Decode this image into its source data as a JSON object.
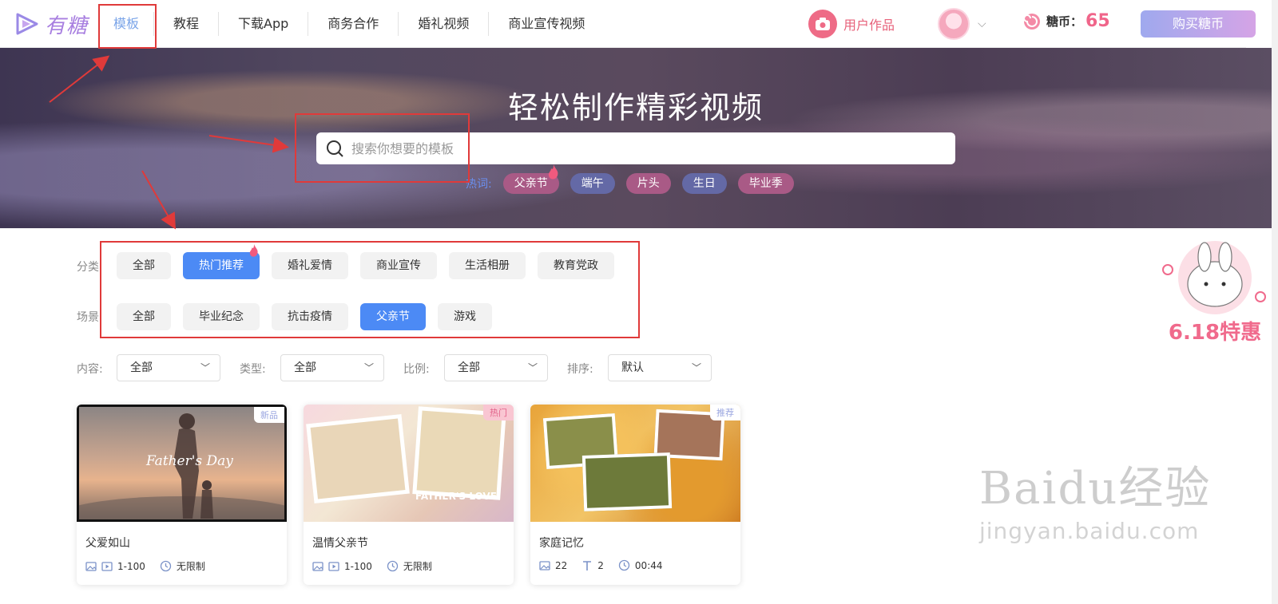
{
  "header": {
    "logo_text": "有糖",
    "nav": [
      "模板",
      "教程",
      "下载App",
      "商务合作",
      "婚礼视频",
      "商业宣传视频"
    ],
    "user_works": "用户作品",
    "candy_label": "糖币：",
    "candy_count": "65",
    "buy_button": "购买糖币"
  },
  "banner": {
    "title": "轻松制作精彩视频",
    "search_placeholder": "搜索你想要的模板",
    "hot_label": "热词:",
    "hot_tags": [
      "父亲节",
      "端午",
      "片头",
      "生日",
      "毕业季"
    ]
  },
  "filters": {
    "category_label": "分类",
    "categories": [
      "全部",
      "热门推荐",
      "婚礼爱情",
      "商业宣传",
      "生活相册",
      "教育党政"
    ],
    "active_category": "热门推荐",
    "scene_label": "场景",
    "scenes": [
      "全部",
      "毕业纪念",
      "抗击疫情",
      "父亲节",
      "游戏"
    ],
    "active_scene": "父亲节",
    "dropdowns": [
      {
        "label": "内容:",
        "value": "全部"
      },
      {
        "label": "类型:",
        "value": "全部"
      },
      {
        "label": "比例:",
        "value": "全部"
      },
      {
        "label": "排序:",
        "value": "默认"
      }
    ]
  },
  "cards": [
    {
      "badge": "新品",
      "badge_color": "#9aa6e0",
      "thumb_text": "Father's Day",
      "title": "父爱如山",
      "meta1": "1-100",
      "meta2": "无限制",
      "meta_type": "media"
    },
    {
      "badge": "热门",
      "badge_color": "#f08aa6",
      "thumb_text": "FATHER'S LOVE",
      "title": "温情父亲节",
      "meta1": "1-100",
      "meta2": "无限制",
      "meta_type": "media"
    },
    {
      "badge": "推荐",
      "badge_color": "#9aa6e0",
      "thumb_text": "",
      "title": "家庭记忆",
      "meta1": "22",
      "meta2": "2",
      "meta3": "00:44",
      "meta_type": "text"
    }
  ],
  "promo": {
    "text": "6.18特惠"
  },
  "watermark": {
    "brand": "Baidu经验",
    "url": "jingyan.baidu.com"
  },
  "colors": {
    "accent": "#4c8af5",
    "candy": "#f0658a",
    "annotation": "#e03a3a"
  }
}
